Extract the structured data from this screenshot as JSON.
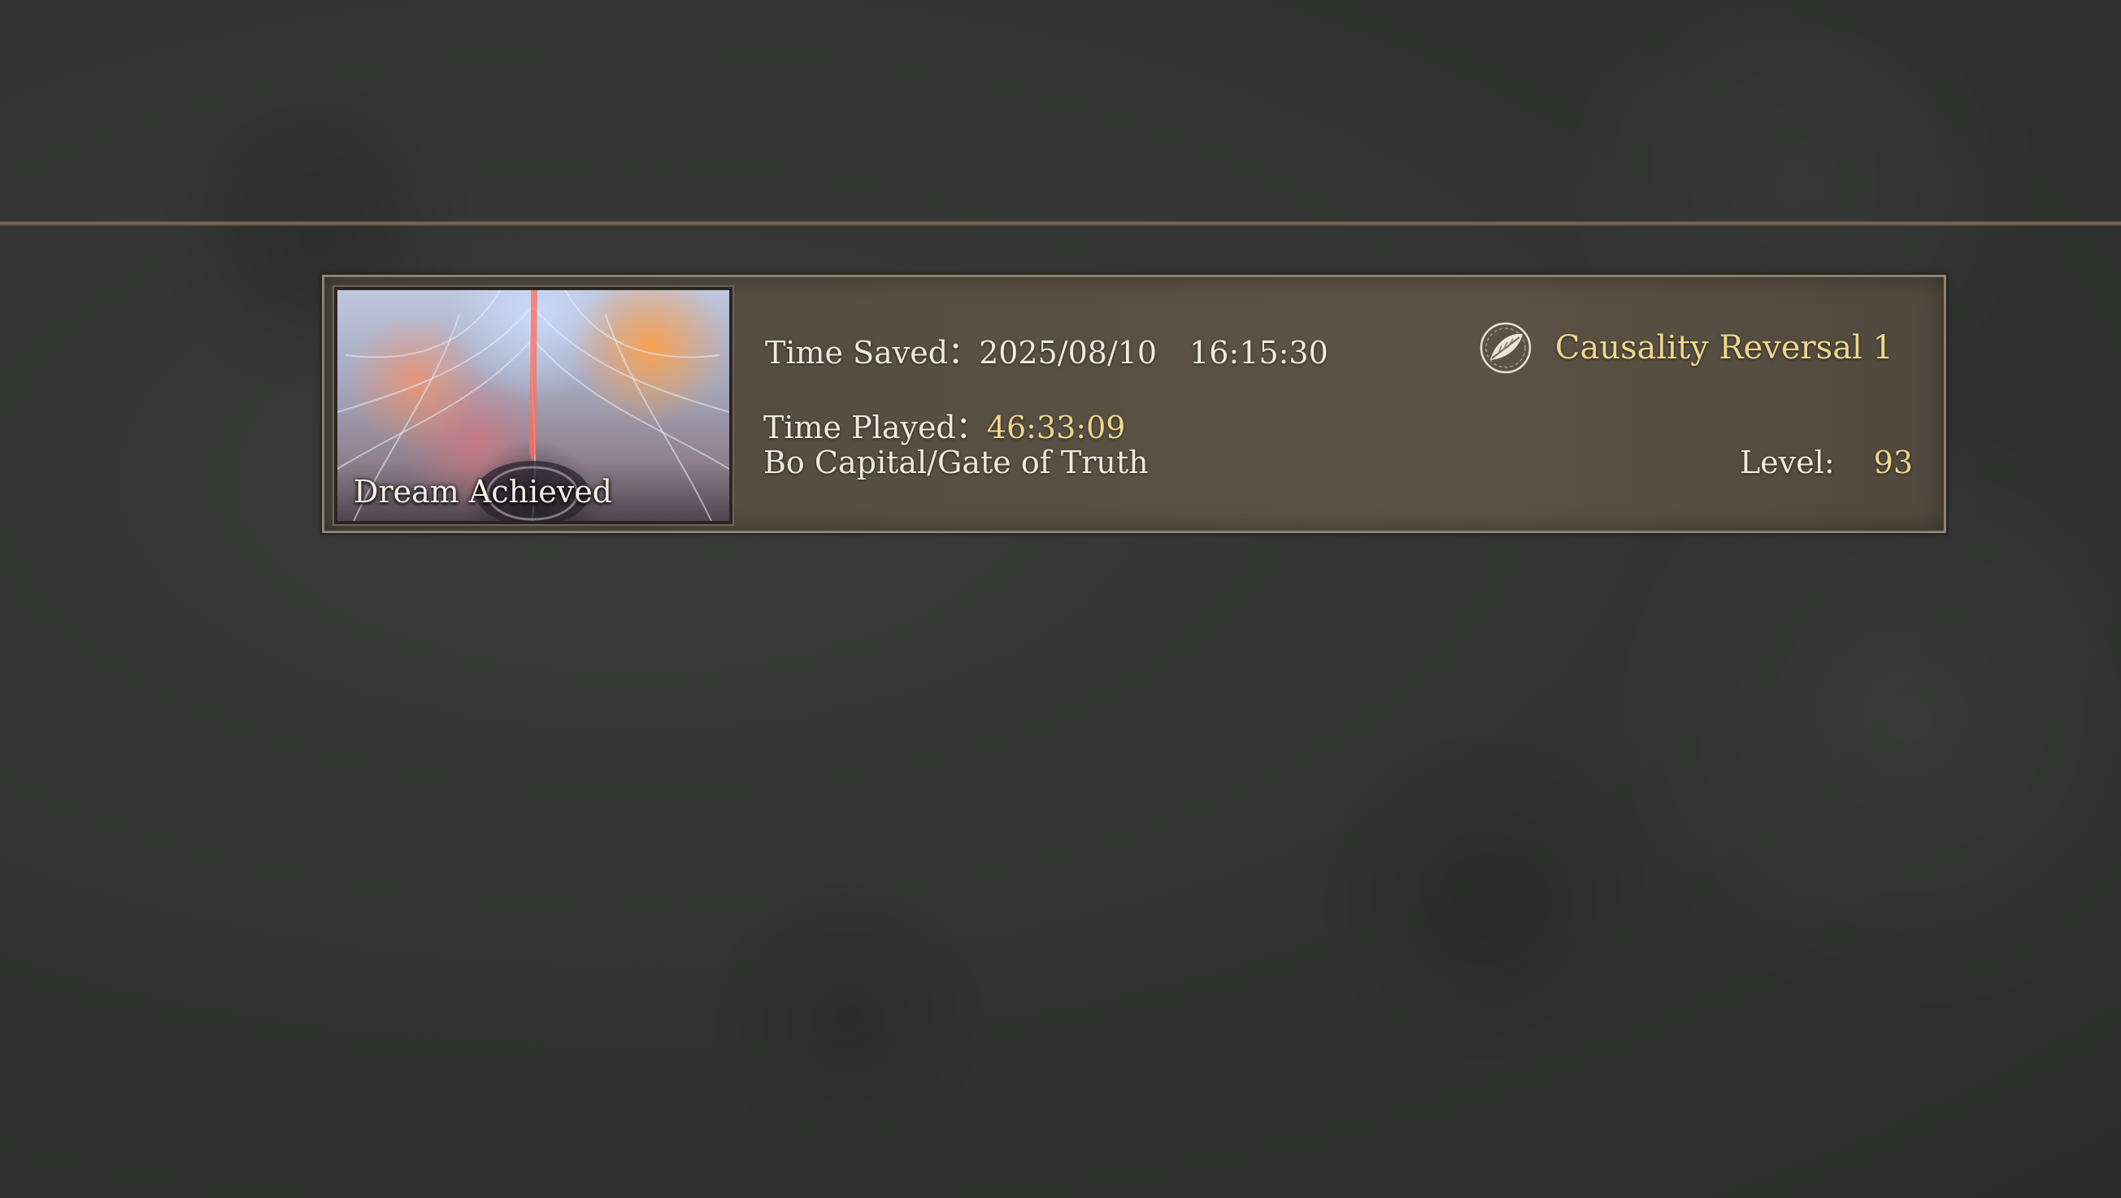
{
  "save_slot": {
    "thumbnail_caption": "Dream Achieved",
    "time_saved_label": "Time Saved：",
    "time_saved_date": "2025/08/10",
    "time_saved_time": "16:15:30",
    "time_played_label": "Time Played：",
    "time_played_value": "46:33:09",
    "location": "Bo Capital/Gate of Truth",
    "difficulty_icon": "feather-seal-icon",
    "difficulty_label": "Causality Reversal 1",
    "level_label": "Level:",
    "level_value": "93"
  },
  "colors": {
    "accent_gold": "#f0d68c",
    "text_light": "#efe9df",
    "frame_border": "#8c8170",
    "divider": "#8a7a5e"
  }
}
